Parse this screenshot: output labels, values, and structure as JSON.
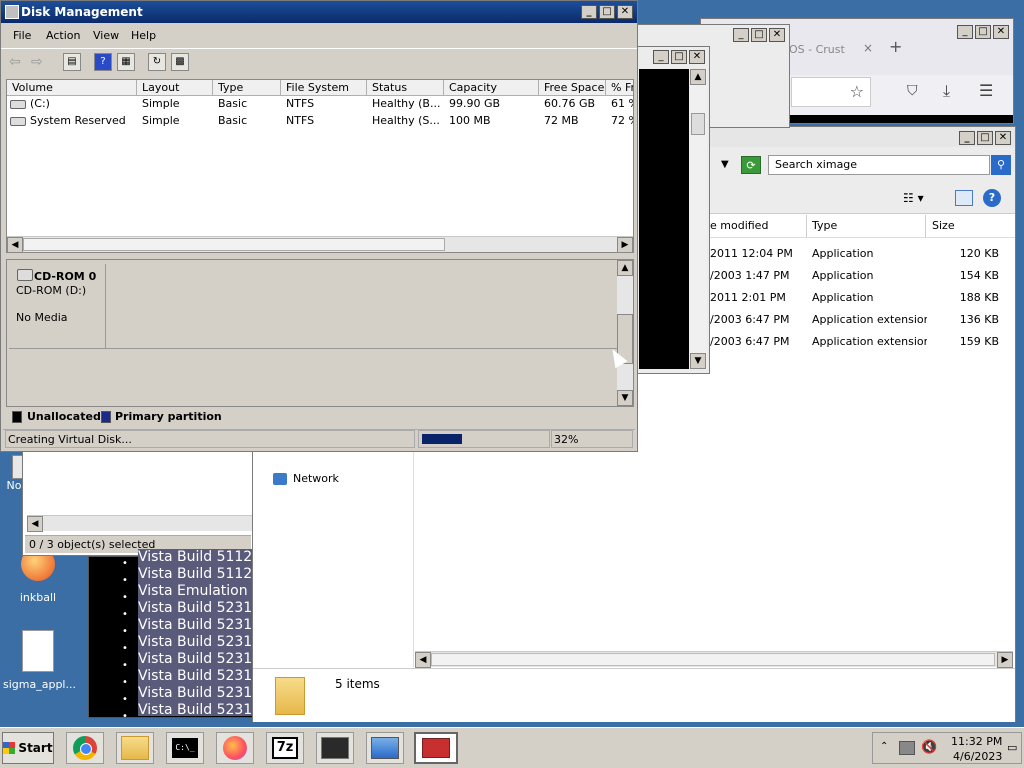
{
  "desktop": {
    "icons": [
      {
        "label": "No",
        "name": "partial-desktop-icon"
      },
      {
        "label": "inkball",
        "name": "inkball"
      },
      {
        "label": "sigma_appl...",
        "name": "sigma-file"
      }
    ]
  },
  "disk_mgmt": {
    "title": "Disk Management",
    "menu": [
      "File",
      "Action",
      "View",
      "Help"
    ],
    "columns": [
      "Volume",
      "Layout",
      "Type",
      "File System",
      "Status",
      "Capacity",
      "Free Space",
      "% Fr"
    ],
    "volumes": [
      [
        "(C:)",
        "Simple",
        "Basic",
        "NTFS",
        "Healthy (B...",
        "99.90 GB",
        "60.76 GB",
        "61 %"
      ],
      [
        "System Reserved",
        "Simple",
        "Basic",
        "NTFS",
        "Healthy (S...",
        "100 MB",
        "72 MB",
        "72 %"
      ]
    ],
    "disk": {
      "name": "CD-ROM 0",
      "sub": "CD-ROM (D:)",
      "media": "No Media"
    },
    "legend": [
      "Unallocated",
      "Primary partition"
    ],
    "legend_colors": [
      "#000000",
      "#1a2a8a"
    ],
    "status_text": "Creating Virtual Disk...",
    "progress": 32,
    "progress_label": "32%"
  },
  "browser": {
    "tab_text": "OS - Crust",
    "tab_close": "×",
    "newtab": "+"
  },
  "explorer": {
    "search_placeholder": "Search ximage",
    "columns": [
      "e modified",
      "Type",
      "Size"
    ],
    "rows": [
      [
        "2011 12:04 PM",
        "Application",
        "120 KB"
      ],
      [
        "/2003 1:47 PM",
        "Application",
        "154 KB"
      ],
      [
        "2011 2:01 PM",
        "Application",
        "188 KB"
      ],
      [
        "/2003 6:47 PM",
        "Application extension",
        "136 KB"
      ],
      [
        "/2003 6:47 PM",
        "Application extension",
        "159 KB"
      ]
    ],
    "network_label": "Network",
    "items_count": "5 items"
  },
  "small_window": {
    "status": "0 / 3 object(s) selected"
  },
  "text_list": [
    "Vista Build 5112",
    "Vista Build 5112",
    "Vista Emulation",
    "Vista Build 5231",
    "Vista Build 5231",
    "Vista Build 5231",
    "Vista Build 5231",
    "Vista Build 5231",
    "Vista Build 5231",
    "Vista Build 5231"
  ],
  "taskbar": {
    "start": "Start",
    "clock_time": "11:32 PM",
    "clock_date": "4/6/2023",
    "cmd_text": "C:\\_"
  }
}
